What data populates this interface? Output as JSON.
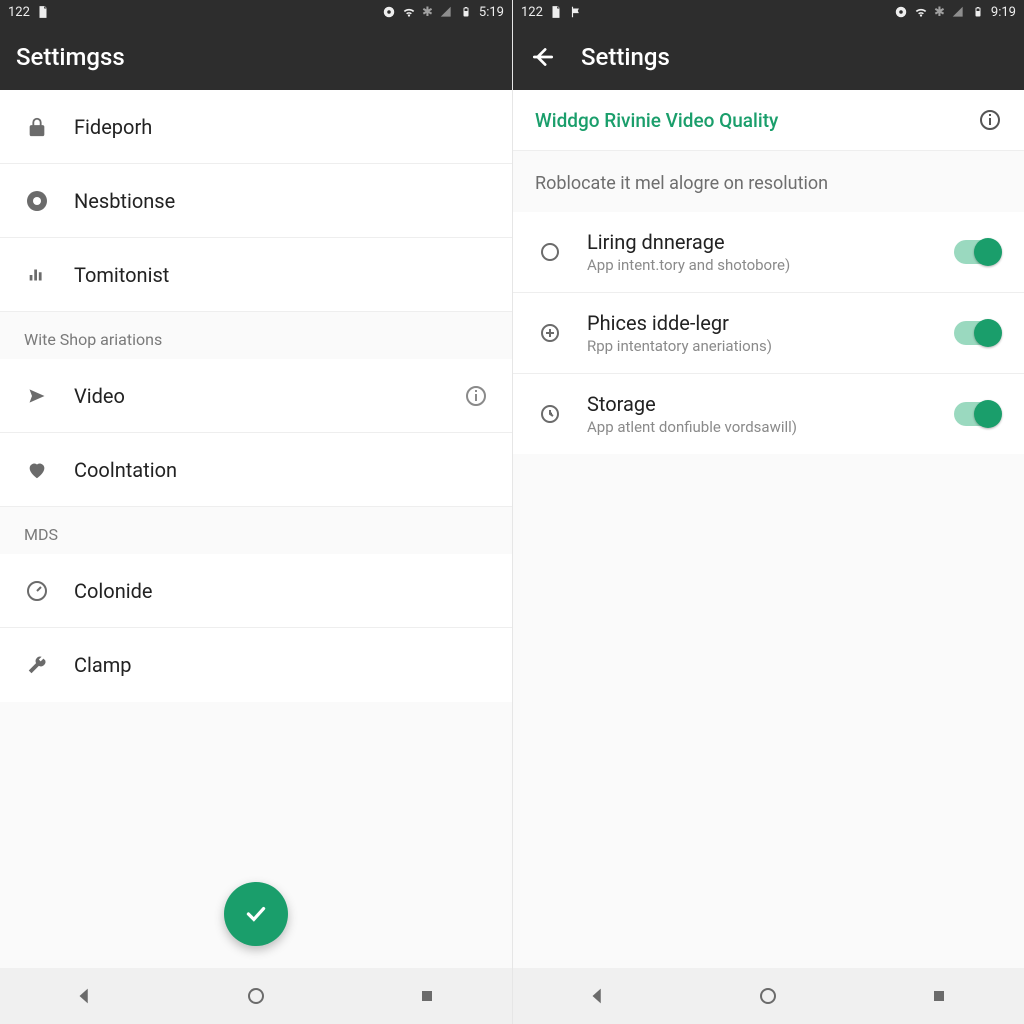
{
  "left": {
    "status": {
      "left_text": "122",
      "clock": "5:19"
    },
    "appbar_title": "Settimgss",
    "items": [
      {
        "icon": "lock",
        "title": "Fideporh"
      },
      {
        "icon": "camera",
        "title": "Nesbtionse"
      },
      {
        "icon": "bars",
        "title": "Tomitonist"
      }
    ],
    "section1_label": "Wite Shop ariations",
    "items2": [
      {
        "icon": "send",
        "title": "Video",
        "has_info": true
      },
      {
        "icon": "heart",
        "title": "Coolntation"
      }
    ],
    "section2_label": "MDS",
    "items3": [
      {
        "icon": "gauge",
        "title": "Colonide"
      },
      {
        "icon": "wrench",
        "title": "Clamp"
      }
    ]
  },
  "right": {
    "status": {
      "left_text": "122",
      "clock": "9:19"
    },
    "appbar_title": "Settings",
    "header_title": "Widdgo Rivinie Video Quality",
    "desc": "Roblocate it mel alogre on resolution",
    "rows": [
      {
        "icon": "circle",
        "title": "Liring dnnerage",
        "sub": "App intent.tory and shotobore)",
        "toggle": true
      },
      {
        "icon": "plus-circle",
        "title": "Phices idde-legr",
        "sub": "Rpp intentatory aneriations)",
        "toggle": true
      },
      {
        "icon": "clock",
        "title": "Storage",
        "sub": "App atlent donfiuble vordsawill)",
        "toggle": true
      }
    ]
  }
}
